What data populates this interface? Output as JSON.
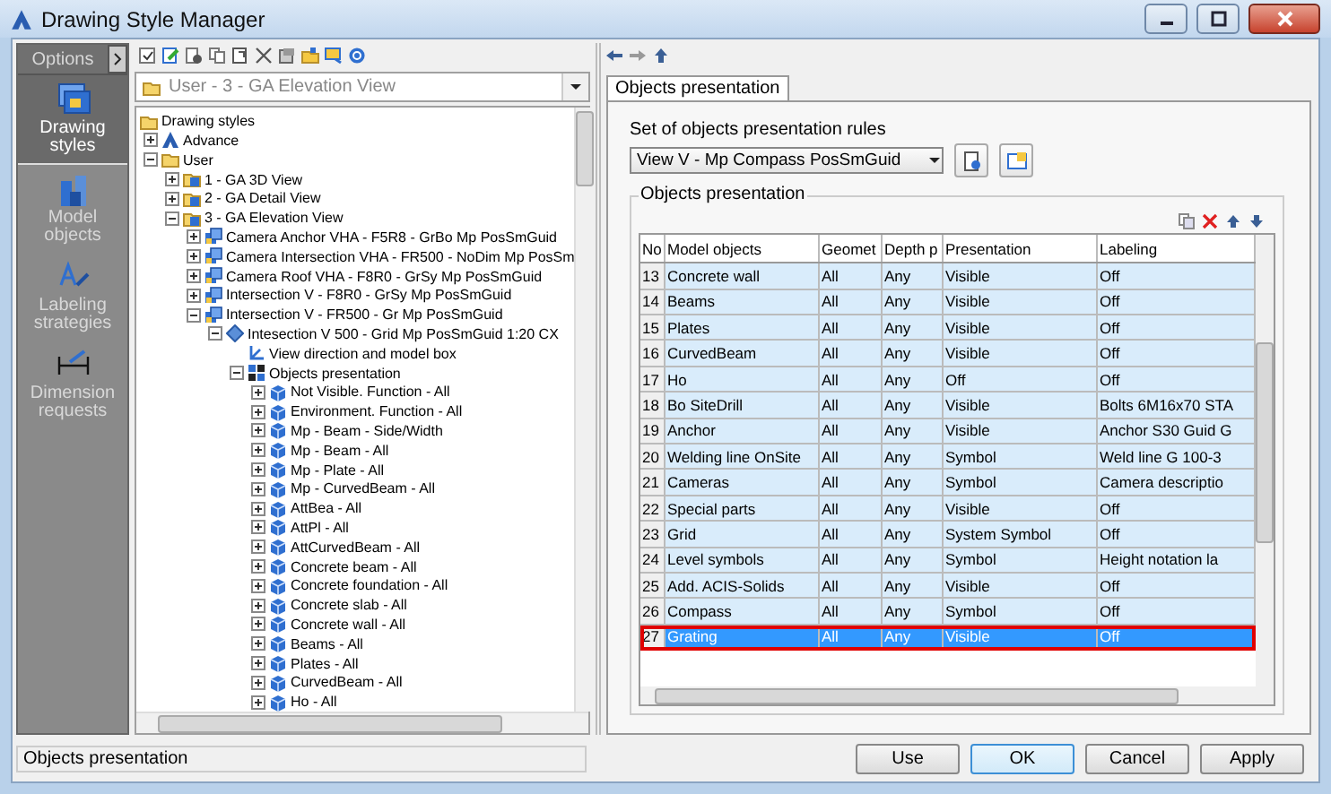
{
  "window": {
    "title": "Drawing Style Manager"
  },
  "options": {
    "title": "Options",
    "items": [
      {
        "label": "Drawing styles",
        "kind": "styles",
        "selected": true
      },
      {
        "label": "Model objects",
        "kind": "objects",
        "selected": false
      },
      {
        "label": "Labeling strategies",
        "kind": "labeling",
        "selected": false
      },
      {
        "label": "Dimension requests",
        "kind": "dimension",
        "selected": false
      }
    ]
  },
  "style_picker": {
    "value": "User - 3 - GA Elevation View"
  },
  "tree": [
    {
      "label": "Drawing styles",
      "kind": "folder",
      "children": [
        {
          "label": "Advance",
          "kind": "advance",
          "expanded": false
        },
        {
          "label": "User",
          "kind": "folder",
          "expanded": true,
          "children": [
            {
              "label": "1 - GA 3D View",
              "kind": "style",
              "expanded": false
            },
            {
              "label": "2 - GA Detail View",
              "kind": "style",
              "expanded": false
            },
            {
              "label": "3 - GA Elevation View",
              "kind": "style",
              "expanded": true,
              "children": [
                {
                  "label": "Camera Anchor VHA - F5R8 - GrBo Mp PosSmGuid",
                  "kind": "camera",
                  "expanded": false
                },
                {
                  "label": "Camera Intersection VHA - FR500 - NoDim Mp PosSm",
                  "kind": "camera",
                  "expanded": false
                },
                {
                  "label": "Camera Roof VHA - F8R0 - GrSy Mp PosSmGuid",
                  "kind": "camera",
                  "expanded": false
                },
                {
                  "label": "Intersection V - F8R0 - GrSy Mp PosSmGuid",
                  "kind": "camera",
                  "expanded": false
                },
                {
                  "label": "Intersection V - FR500 - Gr Mp PosSmGuid",
                  "kind": "camera",
                  "expanded": true,
                  "children": [
                    {
                      "label": "Intesection V 500 - Grid Mp PosSmGuid 1:20 CX",
                      "kind": "preset",
                      "expanded": true,
                      "children": [
                        {
                          "label": "View direction and model box",
                          "kind": "viewdir"
                        },
                        {
                          "label": "Objects presentation",
                          "kind": "objpres",
                          "expanded": true,
                          "children": [
                            {
                              "label": "Not Visible. Function - All",
                              "kind": "rule",
                              "expanded": false
                            },
                            {
                              "label": "Environment. Function - All",
                              "kind": "rule",
                              "expanded": false
                            },
                            {
                              "label": "Mp - Beam - Side/Width",
                              "kind": "rule",
                              "expanded": false
                            },
                            {
                              "label": "Mp - Beam - All",
                              "kind": "rule",
                              "expanded": false
                            },
                            {
                              "label": "Mp - Plate - All",
                              "kind": "rule",
                              "expanded": false
                            },
                            {
                              "label": "Mp - CurvedBeam - All",
                              "kind": "rule",
                              "expanded": false
                            },
                            {
                              "label": "AttBea - All",
                              "kind": "rule",
                              "expanded": false
                            },
                            {
                              "label": "AttPl - All",
                              "kind": "rule",
                              "expanded": false
                            },
                            {
                              "label": "AttCurvedBeam - All",
                              "kind": "rule",
                              "expanded": false
                            },
                            {
                              "label": "Concrete beam - All",
                              "kind": "rule",
                              "expanded": false
                            },
                            {
                              "label": "Concrete foundation - All",
                              "kind": "rule",
                              "expanded": false
                            },
                            {
                              "label": "Concrete slab - All",
                              "kind": "rule",
                              "expanded": false
                            },
                            {
                              "label": "Concrete wall - All",
                              "kind": "rule",
                              "expanded": false
                            },
                            {
                              "label": "Beams - All",
                              "kind": "rule",
                              "expanded": false
                            },
                            {
                              "label": "Plates - All",
                              "kind": "rule",
                              "expanded": false
                            },
                            {
                              "label": "CurvedBeam - All",
                              "kind": "rule",
                              "expanded": false
                            },
                            {
                              "label": "Ho - All",
                              "kind": "rule",
                              "expanded": false
                            }
                          ]
                        }
                      ]
                    }
                  ]
                }
              ]
            }
          ]
        }
      ]
    }
  ],
  "tab": {
    "label": "Objects presentation",
    "selected": true
  },
  "rules_set": {
    "label": "Set of objects presentation rules",
    "value": "View V - Mp Compass PosSmGuid"
  },
  "table": {
    "group_title": "Objects presentation",
    "columns": [
      "No",
      "Model objects",
      "Geomet",
      "Depth p",
      "Presentation",
      "Labeling"
    ],
    "rows": [
      {
        "cells": [
          "13",
          "Concrete wall",
          "All",
          "Any",
          "Visible",
          "Off"
        ],
        "selected": false
      },
      {
        "cells": [
          "14",
          "Beams",
          "All",
          "Any",
          "Visible",
          "Off"
        ],
        "selected": false
      },
      {
        "cells": [
          "15",
          "Plates",
          "All",
          "Any",
          "Visible",
          "Off"
        ],
        "selected": false
      },
      {
        "cells": [
          "16",
          "CurvedBeam",
          "All",
          "Any",
          "Visible",
          "Off"
        ],
        "selected": false
      },
      {
        "cells": [
          "17",
          "Ho",
          "All",
          "Any",
          "Off",
          "Off"
        ],
        "selected": false
      },
      {
        "cells": [
          "18",
          "Bo SiteDrill",
          "All",
          "Any",
          "Visible",
          "Bolts 6M16x70 STA"
        ],
        "selected": false
      },
      {
        "cells": [
          "19",
          "Anchor",
          "All",
          "Any",
          "Visible",
          "Anchor S30 Guid G"
        ],
        "selected": false
      },
      {
        "cells": [
          "20",
          "Welding line OnSite",
          "All",
          "Any",
          "Symbol",
          "Weld line G 100-3"
        ],
        "selected": false
      },
      {
        "cells": [
          "21",
          "Cameras",
          "All",
          "Any",
          "Symbol",
          "Camera descriptio"
        ],
        "selected": false
      },
      {
        "cells": [
          "22",
          "Special parts",
          "All",
          "Any",
          "Visible",
          "Off"
        ],
        "selected": false
      },
      {
        "cells": [
          "23",
          "Grid",
          "All",
          "Any",
          "System Symbol",
          "Off"
        ],
        "selected": false
      },
      {
        "cells": [
          "24",
          "Level symbols",
          "All",
          "Any",
          "Symbol",
          "Height notation la"
        ],
        "selected": false
      },
      {
        "cells": [
          "25",
          "Add. ACIS-Solids",
          "All",
          "Any",
          "Visible",
          "Off"
        ],
        "selected": false
      },
      {
        "cells": [
          "26",
          "Compass",
          "All",
          "Any",
          "Symbol",
          "Off"
        ],
        "selected": false
      },
      {
        "cells": [
          "27",
          "Grating",
          "All",
          "Any",
          "Visible",
          "Off"
        ],
        "selected": true
      }
    ]
  },
  "status_bar": "Objects presentation",
  "buttons": [
    {
      "label": "Use",
      "focused": false
    },
    {
      "label": "OK",
      "focused": true
    },
    {
      "label": "Cancel",
      "focused": false
    },
    {
      "label": "Apply",
      "focused": false
    }
  ]
}
